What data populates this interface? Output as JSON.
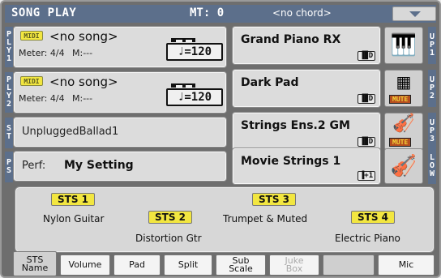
{
  "header": {
    "title": "SONG PLAY",
    "mt": "MT: 0",
    "chord": "<no chord>"
  },
  "players": [
    {
      "tag": [
        "P",
        "L",
        "Y",
        "1"
      ],
      "midi": "MIDI",
      "song": "<no song>",
      "meter": "Meter: 4/4",
      "measure": "M:---",
      "tempo": "♩=120"
    },
    {
      "tag": [
        "P",
        "L",
        "Y",
        "2"
      ],
      "midi": "MIDI",
      "song": "<no song>",
      "meter": "Meter: 4/4",
      "measure": "M:---",
      "tempo": "♩=120"
    }
  ],
  "style": {
    "tag": [
      "S",
      "T"
    ],
    "name": "UnpluggedBallad1"
  },
  "performance": {
    "tag": [
      "P",
      "S"
    ],
    "prefix": "Perf:",
    "name": "My Setting"
  },
  "upper_tracks": [
    {
      "tag": [
        "U",
        "P",
        "1"
      ],
      "name": "Grand Piano RX",
      "badge": "▐▉D",
      "icon": "grand-piano-icon",
      "muted": false
    },
    {
      "tag": [
        "U",
        "P",
        "2"
      ],
      "name": "Dark Pad",
      "badge": "▐▉D",
      "icon": "pad-icon",
      "muted": true,
      "mute_label": "MUTE"
    },
    {
      "tag": [
        "U",
        "P",
        "3"
      ],
      "name": "Strings Ens.2 GM",
      "badge": "▐▉D",
      "icon": "strings-icon",
      "muted": true,
      "mute_label": "MUTE"
    },
    {
      "tag": [
        "L",
        "O",
        "W"
      ],
      "name": "Movie Strings 1",
      "badge": "▐+1",
      "icon": "violin-icon",
      "muted": false
    }
  ],
  "sts": {
    "buttons": [
      "STS 1",
      "STS 2",
      "STS 3",
      "STS 4"
    ],
    "names": [
      "Nylon Guitar",
      "Distortion Gtr",
      "Trumpet & Muted",
      "Electric Piano"
    ]
  },
  "tabs": [
    {
      "line1": "STS",
      "line2": "Name",
      "active": true,
      "disabled": false
    },
    {
      "line1": "Volume",
      "line2": "",
      "active": false,
      "disabled": false
    },
    {
      "line1": "Pad",
      "line2": "",
      "active": false,
      "disabled": false
    },
    {
      "line1": "Split",
      "line2": "",
      "active": false,
      "disabled": false
    },
    {
      "line1": "Sub",
      "line2": "Scale",
      "active": false,
      "disabled": false
    },
    {
      "line1": "Juke",
      "line2": "Box",
      "active": false,
      "disabled": true
    },
    {
      "line1": "",
      "line2": "",
      "active": false,
      "disabled": false
    },
    {
      "line1": "Mic",
      "line2": "",
      "active": false,
      "disabled": false
    }
  ]
}
